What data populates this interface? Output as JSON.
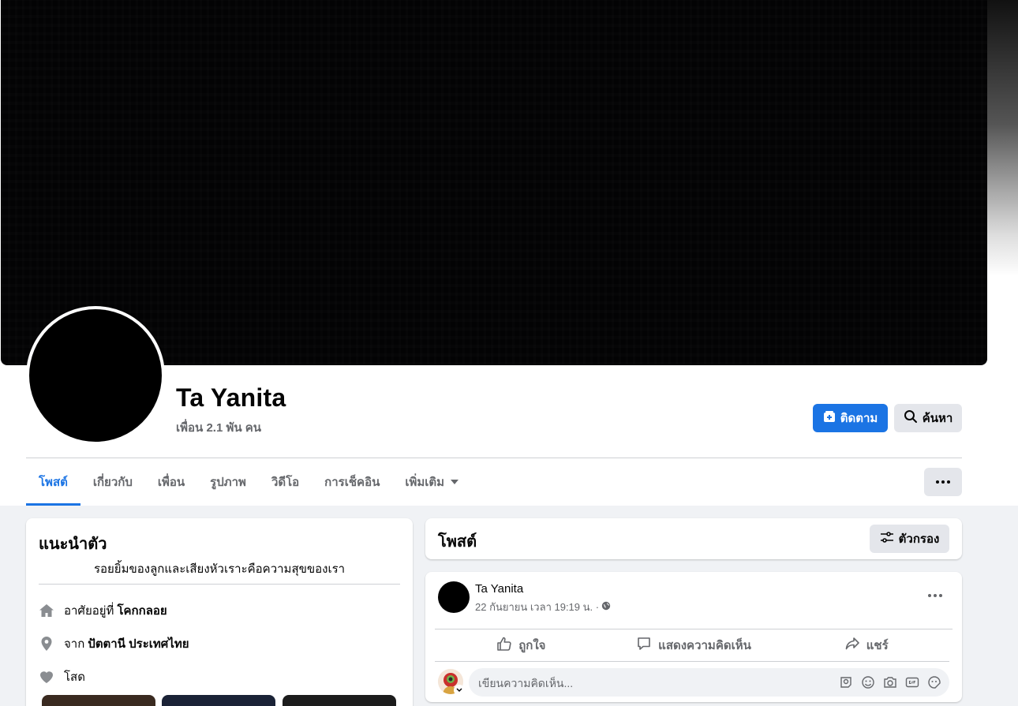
{
  "profile": {
    "name": "Ta Yanita",
    "friends": "เพื่อน 2.1 พัน คน"
  },
  "actions": {
    "follow_label": "ติดตาม",
    "search_label": "ค้นหา"
  },
  "tabs": [
    {
      "label": "โพสต์",
      "active": true
    },
    {
      "label": "เกี่ยวกับ"
    },
    {
      "label": "เพื่อน"
    },
    {
      "label": "รูปภาพ"
    },
    {
      "label": "วิดีโอ"
    },
    {
      "label": "การเช็คอิน"
    },
    {
      "label": "เพิ่มเติม"
    }
  ],
  "intro": {
    "title": "แนะนำตัว",
    "bio": "รอยยิ้มของลูกและเสียงหัวเราะคือความสุขของเรา",
    "lives_prefix": "อาศัยอยู่ที่",
    "lives_value": "โคกกลอย",
    "from_prefix": "จาก",
    "from_value": "ปัตตานี ประเทศไทย",
    "relationship": "โสด"
  },
  "posts": {
    "title": "โพสต์",
    "filter_label": "ตัวกรอง"
  },
  "post": {
    "author": "Ta Yanita",
    "time": "22 กันยายน เวลา 19:19 น. ·",
    "like_label": "ถูกใจ",
    "comment_label": "แสดงความคิดเห็น",
    "share_label": "แชร์",
    "comment_placeholder": "เขียนความคิดเห็น..."
  },
  "colors": {
    "accent": "#1b74e4",
    "secondary_text": "#65676b",
    "button_gray": "#e4e6eb"
  }
}
